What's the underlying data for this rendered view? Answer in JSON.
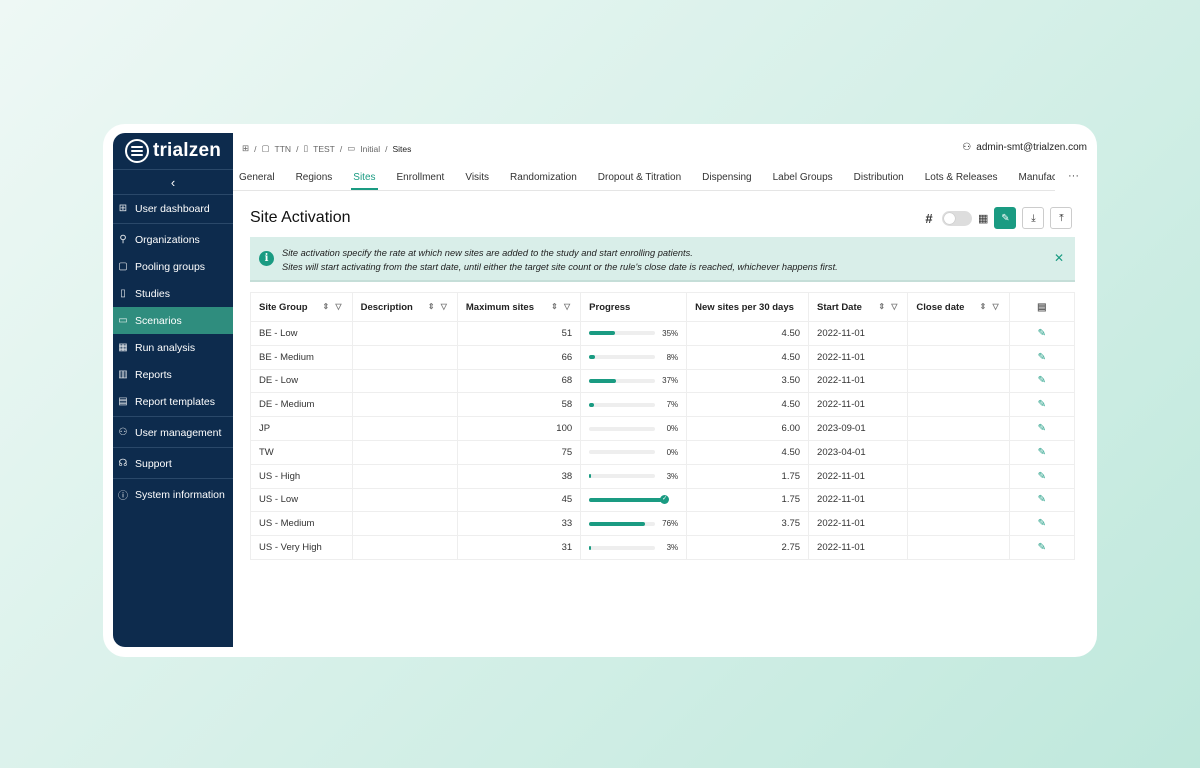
{
  "brand": {
    "name": "trialzen"
  },
  "sidebar": {
    "items": [
      {
        "label": "User dashboard",
        "icon": "grid-icon",
        "glyph": "⊞"
      },
      {
        "label": "Organizations",
        "icon": "org-tree-icon",
        "glyph": "⚲"
      },
      {
        "label": "Pooling groups",
        "icon": "document-icon",
        "glyph": "▢"
      },
      {
        "label": "Studies",
        "icon": "file-icon",
        "glyph": "▯"
      },
      {
        "label": "Scenarios",
        "icon": "book-icon",
        "glyph": "▭",
        "active": true
      },
      {
        "label": "Run analysis",
        "icon": "calculator-icon",
        "glyph": "▦"
      },
      {
        "label": "Reports",
        "icon": "bar-chart-icon",
        "glyph": "▥"
      },
      {
        "label": "Report templates",
        "icon": "template-icon",
        "glyph": "▤"
      },
      {
        "label": "User management",
        "icon": "users-icon",
        "glyph": "⚇"
      },
      {
        "label": "Support",
        "icon": "headset-icon",
        "glyph": "☊"
      },
      {
        "label": "System information",
        "icon": "info-icon",
        "glyph": "ⓘ"
      }
    ]
  },
  "breadcrumb": [
    "TTN",
    "TEST",
    "Initial",
    "Sites"
  ],
  "user": {
    "email": "admin-smt@trialzen.com"
  },
  "tabs": [
    "General",
    "Regions",
    "Sites",
    "Enrollment",
    "Visits",
    "Randomization",
    "Dropout & Titration",
    "Dispensing",
    "Label Groups",
    "Distribution",
    "Lots & Releases",
    "Manufac"
  ],
  "active_tab": "Sites",
  "page": {
    "title": "Site Activation"
  },
  "info": {
    "line1": "Site activation specify the rate at which new sites are added to the study and start enrolling patients.",
    "line2": "Sites will start activating from the start date, until either the target site count or the rule's close date is reached, whichever happens first."
  },
  "table": {
    "columns": [
      "Site Group",
      "Description",
      "Maximum sites",
      "Progress",
      "New sites per 30 days",
      "Start Date",
      "Close date"
    ],
    "rows": [
      {
        "group": "BE - Low",
        "description": "",
        "max": "51",
        "progress": 35,
        "pct": "35%",
        "rate": "4.50",
        "start": "2022-11-01",
        "close": ""
      },
      {
        "group": "BE - Medium",
        "description": "",
        "max": "66",
        "progress": 8,
        "pct": "8%",
        "rate": "4.50",
        "start": "2022-11-01",
        "close": ""
      },
      {
        "group": "DE - Low",
        "description": "",
        "max": "68",
        "progress": 37,
        "pct": "37%",
        "rate": "3.50",
        "start": "2022-11-01",
        "close": ""
      },
      {
        "group": "DE - Medium",
        "description": "",
        "max": "58",
        "progress": 7,
        "pct": "7%",
        "rate": "4.50",
        "start": "2022-11-01",
        "close": ""
      },
      {
        "group": "JP",
        "description": "",
        "max": "100",
        "progress": 0,
        "pct": "0%",
        "rate": "6.00",
        "start": "2023-09-01",
        "close": ""
      },
      {
        "group": "TW",
        "description": "",
        "max": "75",
        "progress": 0,
        "pct": "0%",
        "rate": "4.50",
        "start": "2023-04-01",
        "close": ""
      },
      {
        "group": "US - High",
        "description": "",
        "max": "38",
        "progress": 3,
        "pct": "3%",
        "rate": "1.75",
        "start": "2022-11-01",
        "close": ""
      },
      {
        "group": "US - Low",
        "description": "",
        "max": "45",
        "progress": 100,
        "pct": "",
        "complete": true,
        "rate": "1.75",
        "start": "2022-11-01",
        "close": ""
      },
      {
        "group": "US - Medium",
        "description": "",
        "max": "33",
        "progress": 76,
        "pct": "76%",
        "rate": "3.75",
        "start": "2022-11-01",
        "close": ""
      },
      {
        "group": "US - Very High",
        "description": "",
        "max": "31",
        "progress": 3,
        "pct": "3%",
        "rate": "2.75",
        "start": "2022-11-01",
        "close": ""
      }
    ]
  },
  "colors": {
    "sidebar": "#0d2b4d",
    "accent": "#1a9b82",
    "active_nav": "#2f8d7e",
    "info_bg": "#d9eee9"
  }
}
